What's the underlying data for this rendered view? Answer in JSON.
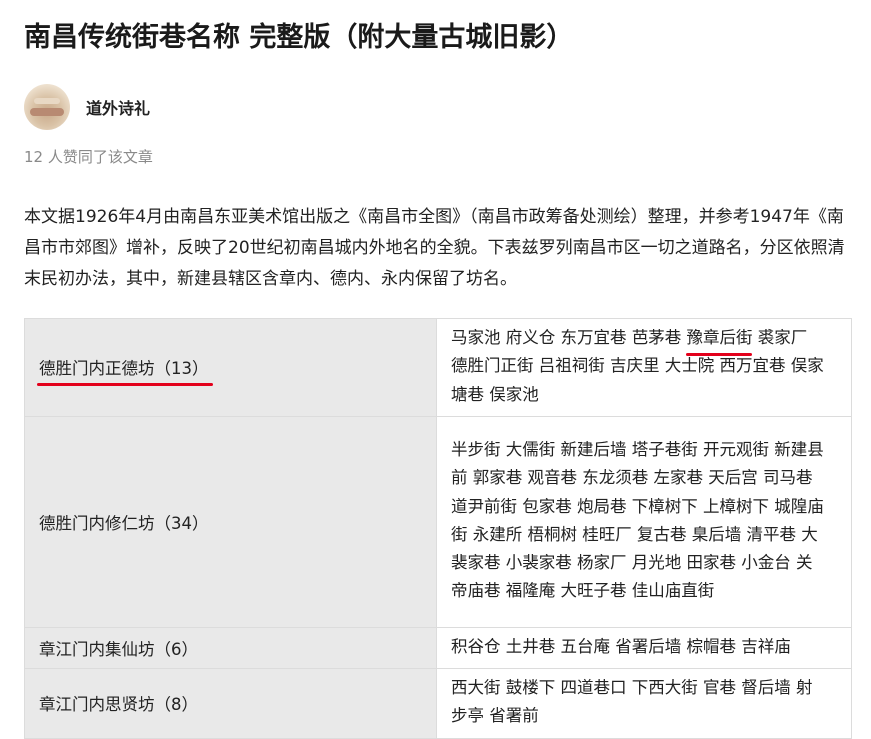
{
  "article": {
    "title": "南昌传统街巷名称 完整版（附大量古城旧影）",
    "author": "道外诗礼",
    "likes": "12 人赞同了该文章",
    "intro": "本文据1926年4月由南昌东亚美术馆出版之《南昌市全图》（南昌市政筹备处测绘）整理，并参考1947年《南昌市市郊图》增补，反映了20世纪初南昌城内外地名的全貌。下表兹罗列南昌市区一切之道路名，分区依照清末民初办法，其中，新建县辖区含章内、德内、永内保留了坊名。"
  },
  "table": {
    "rows": [
      {
        "key": "德胜门内正德坊（13）",
        "before": "马家池 府义仓 东万宜巷 芭茅巷 ",
        "highlight": "豫章后街",
        "after": " 裘家厂 德胜门正街 吕祖祠街 吉庆里 大士院 西万宜巷 俣家塘巷 俣家池"
      },
      {
        "key": "德胜门内修仁坊（34）",
        "streets": "半步街 大儒街 新建后墙 塔子巷街 开元观街 新建县前 郭家巷 观音巷 东龙须巷 左家巷 天后宫 司马巷 道尹前街 包家巷 炮局巷 下樟树下 上樟树下 城隍庙街 永建所 梧桐树 桂旺厂 复古巷 臬后墙 清平巷 大裴家巷 小裴家巷 杨家厂 月光地 田家巷 小金台 关帝庙巷 福隆庵 大旺子巷 佳山庙直街"
      },
      {
        "key": "章江门内集仙坊（6）",
        "streets": "积谷仓 土井巷 五台庵 省署后墙 棕帽巷 吉祥庙"
      },
      {
        "key": "章江门内思贤坊（8）",
        "streets": "西大街 鼓楼下 四道巷口 下西大街 官巷 督后墙 射步亭 省署前"
      }
    ]
  },
  "colors": {
    "underline": "#e3001b",
    "key_cell_bg": "#e9e9e9",
    "likes_text": "#8a8a8a"
  }
}
